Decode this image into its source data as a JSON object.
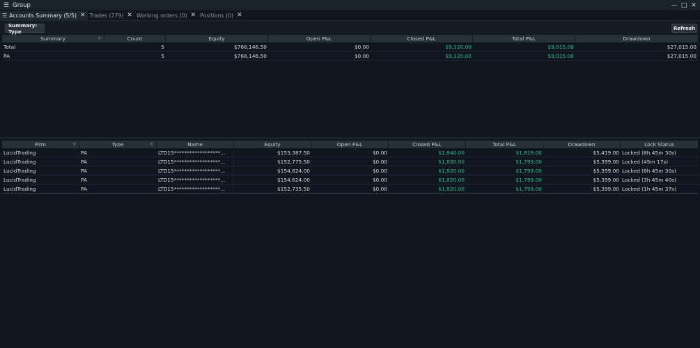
{
  "window": {
    "title": "Group"
  },
  "tabs": [
    {
      "label": "Accounts Summary (5/5)",
      "active": true
    },
    {
      "label": "Trades (279)",
      "active": false
    },
    {
      "label": "Working orders (0)",
      "active": false
    },
    {
      "label": "Positions (0)",
      "active": false
    }
  ],
  "toolbar": {
    "summary_label": "Summary: Type",
    "refresh_label": "Refresh"
  },
  "summary_table": {
    "headers": [
      "Summary",
      "Count",
      "Equity",
      "Open P&L",
      "Closed P&L",
      "Total P&L",
      "Drawdown"
    ],
    "rows": [
      [
        "Total",
        "5",
        "$768,146.50",
        "$0.00",
        "$9,120.00",
        "$9,015.00",
        "$27,015.00"
      ],
      [
        "PA",
        "5",
        "$768,146.50",
        "$0.00",
        "$9,120.00",
        "$9,015.00",
        "$27,015.00"
      ]
    ]
  },
  "accounts_table": {
    "headers": [
      "Firm",
      "Type",
      "Name",
      "Equity",
      "Open P&L",
      "Closed P&L",
      "Total P&L",
      "Drawdown",
      "Lock Status"
    ],
    "rows": [
      [
        "LucidTrading",
        "PA",
        "LTD15******************...",
        "$153,387.50",
        "$0.00",
        "$1,840.00",
        "$1,819.00",
        "$5,419.00",
        "Locked (8h 45m 30s)"
      ],
      [
        "LucidTrading",
        "PA",
        "LTD15******************...",
        "$152,775.50",
        "$0.00",
        "$1,820.00",
        "$1,799.00",
        "$5,399.00",
        "Locked (45m 17s)"
      ],
      [
        "LucidTrading",
        "PA",
        "LTD15******************...",
        "$154,624.00",
        "$0.00",
        "$1,820.00",
        "$1,799.00",
        "$5,399.00",
        "Locked (8h 45m 30s)"
      ],
      [
        "LucidTrading",
        "PA",
        "LTD15******************...",
        "$154,624.00",
        "$0.00",
        "$1,820.00",
        "$1,799.00",
        "$5,399.00",
        "Locked (3h 45m 40s)"
      ],
      [
        "LucidTrading",
        "PA",
        "LTD15******************...",
        "$152,735.50",
        "$0.00",
        "$1,820.00",
        "$1,799.00",
        "$5,399.00",
        "Locked (1h 45m 37s)"
      ]
    ]
  },
  "colors": {
    "positive": "#2fc18c",
    "background": "#0f1620",
    "header": "#28303a"
  }
}
